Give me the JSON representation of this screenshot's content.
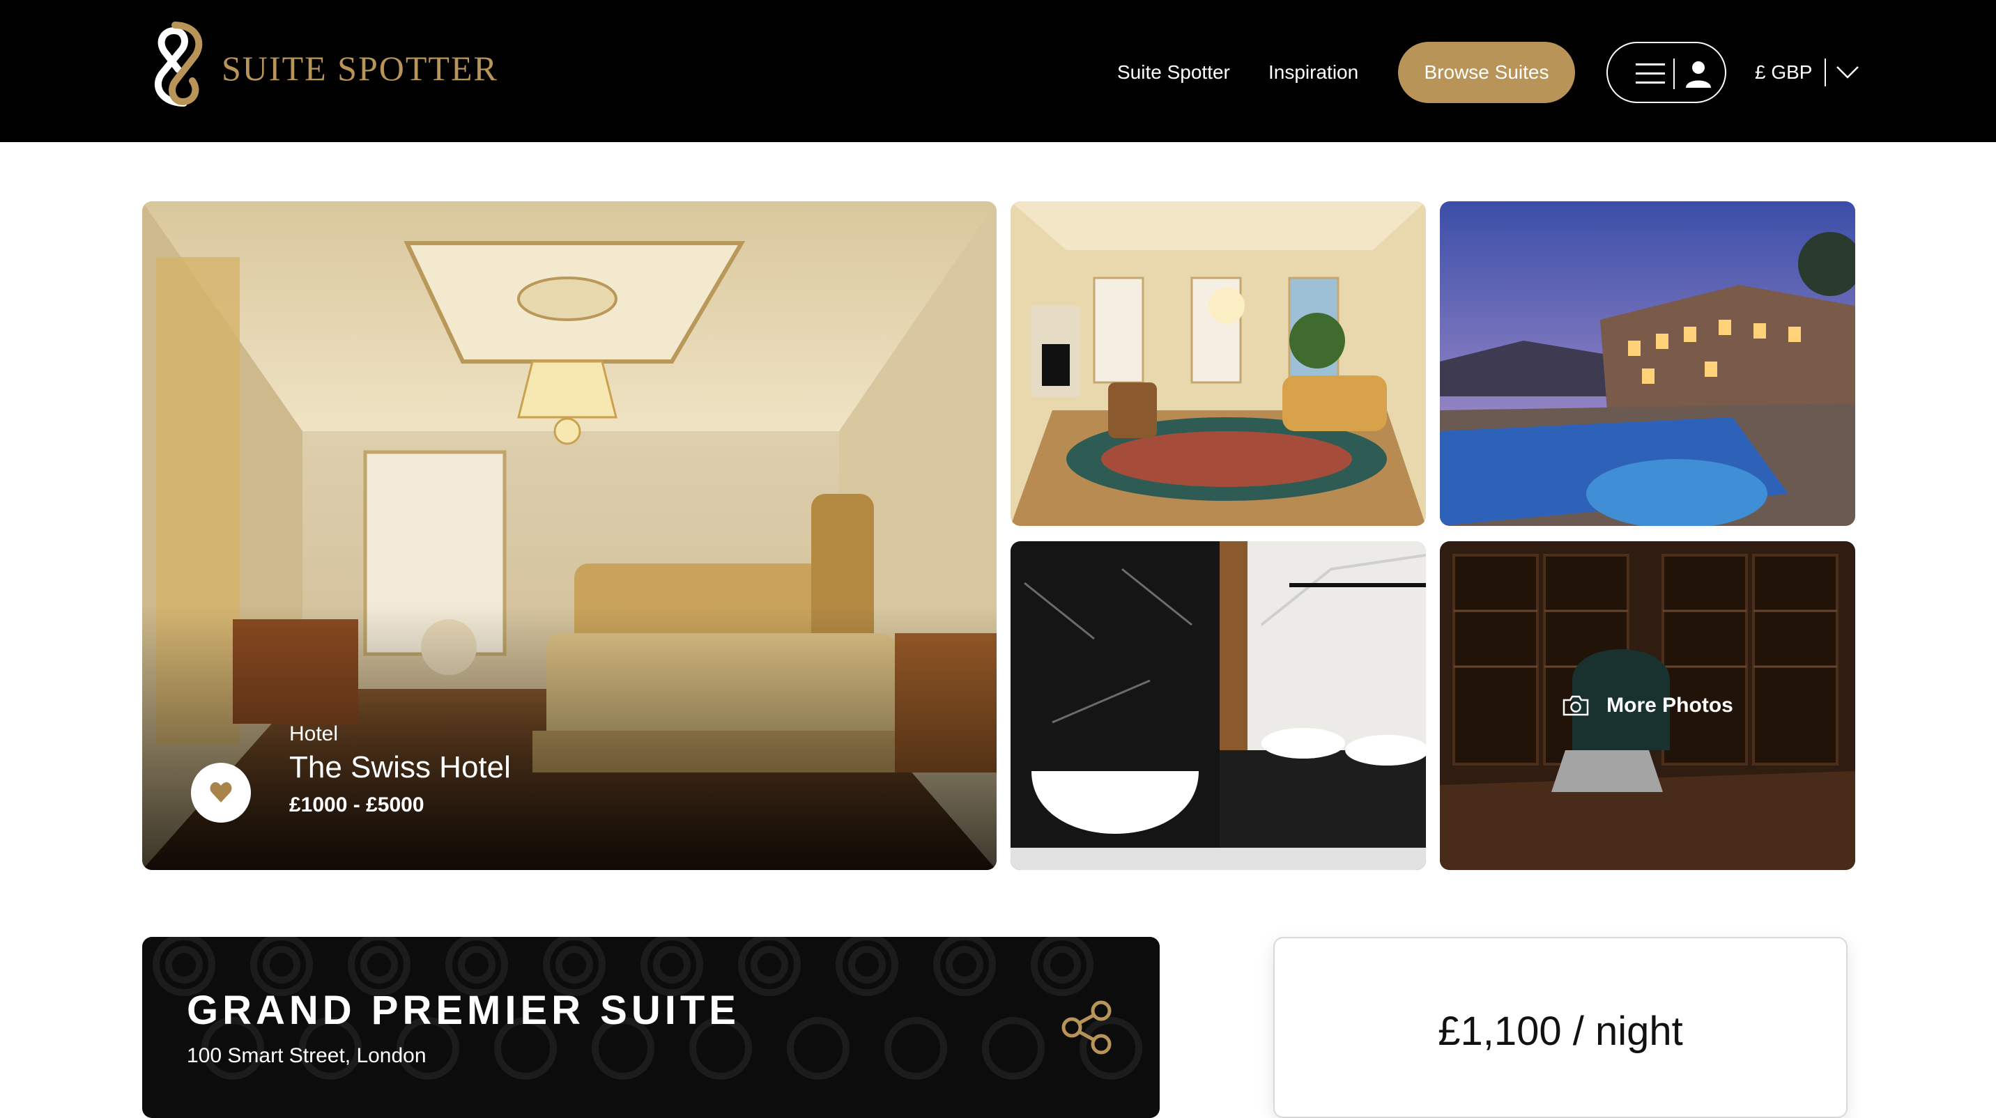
{
  "header": {
    "logo_text": "SUITE SPOTTER",
    "nav": {
      "suite_spotter": "Suite Spotter",
      "inspiration": "Inspiration",
      "browse_suites": "Browse Suites"
    },
    "currency": "£ GBP",
    "icons": [
      "logo-mark-icon",
      "hamburger-menu-icon",
      "user-icon",
      "chevron-down-icon"
    ]
  },
  "gallery": {
    "featured": {
      "type": "Hotel",
      "name": "The Swiss Hotel",
      "price_range": "£1000 - £5000",
      "favorite_icon": "heart-icon"
    },
    "more_photos_label": "More Photos",
    "more_photos_icon": "camera-icon"
  },
  "suite": {
    "title": "GRAND PREMIER SUITE",
    "address": "100 Smart Street, London",
    "share_icon": "share-icon"
  },
  "pricing": {
    "per_night": "£1,100 / night"
  },
  "colors": {
    "brand_gold": "#b89458",
    "header_bg": "#000000",
    "card_dark": "#0c0c0c"
  }
}
